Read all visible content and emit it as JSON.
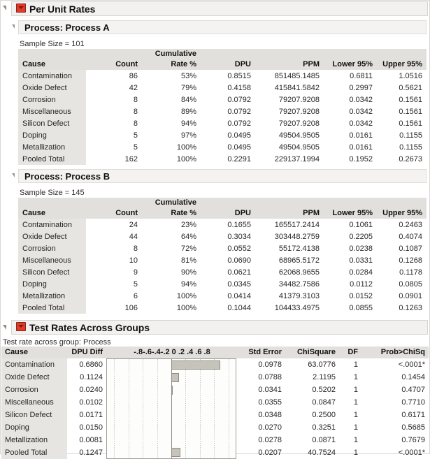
{
  "window": {
    "per_unit_rates_title": "Per Unit Rates",
    "test_rates_title": "Test Rates Across Groups"
  },
  "icons": {
    "popup": "red-popup-triangle-icon",
    "disclosure": "disclosure-triangle-icon"
  },
  "groups": [
    {
      "heading": "Process: Process A",
      "sample_size": "Sample Size = 101",
      "columns": [
        "Cause",
        "Count",
        "Cumulative\nRate %",
        "DPU",
        "PPM",
        "Lower 95%",
        "Upper 95%"
      ],
      "col_head_1": "Cause",
      "col_head_2": "Count",
      "col_head_3a": "Cumulative",
      "col_head_3b": "Rate %",
      "col_head_4": "DPU",
      "col_head_5": "PPM",
      "col_head_6": "Lower 95%",
      "col_head_7": "Upper 95%",
      "rows": [
        {
          "cause": "Contamination",
          "count": "86",
          "rate": "53%",
          "dpu": "0.8515",
          "ppm": "851485.1485",
          "lower": "0.6811",
          "upper": "1.0516"
        },
        {
          "cause": "Oxide Defect",
          "count": "42",
          "rate": "79%",
          "dpu": "0.4158",
          "ppm": "415841.5842",
          "lower": "0.2997",
          "upper": "0.5621"
        },
        {
          "cause": "Corrosion",
          "count": "8",
          "rate": "84%",
          "dpu": "0.0792",
          "ppm": "79207.9208",
          "lower": "0.0342",
          "upper": "0.1561"
        },
        {
          "cause": "Miscellaneous",
          "count": "8",
          "rate": "89%",
          "dpu": "0.0792",
          "ppm": "79207.9208",
          "lower": "0.0342",
          "upper": "0.1561"
        },
        {
          "cause": "Silicon Defect",
          "count": "8",
          "rate": "94%",
          "dpu": "0.0792",
          "ppm": "79207.9208",
          "lower": "0.0342",
          "upper": "0.1561"
        },
        {
          "cause": "Doping",
          "count": "5",
          "rate": "97%",
          "dpu": "0.0495",
          "ppm": "49504.9505",
          "lower": "0.0161",
          "upper": "0.1155"
        },
        {
          "cause": "Metallization",
          "count": "5",
          "rate": "100%",
          "dpu": "0.0495",
          "ppm": "49504.9505",
          "lower": "0.0161",
          "upper": "0.1155"
        },
        {
          "cause": "Pooled Total",
          "count": "162",
          "rate": "100%",
          "dpu": "0.2291",
          "ppm": "229137.1994",
          "lower": "0.1952",
          "upper": "0.2673"
        }
      ]
    },
    {
      "heading": "Process: Process B",
      "sample_size": "Sample Size = 145",
      "col_head_1": "Cause",
      "col_head_2": "Count",
      "col_head_3a": "Cumulative",
      "col_head_3b": "Rate %",
      "col_head_4": "DPU",
      "col_head_5": "PPM",
      "col_head_6": "Lower 95%",
      "col_head_7": "Upper 95%",
      "rows": [
        {
          "cause": "Contamination",
          "count": "24",
          "rate": "23%",
          "dpu": "0.1655",
          "ppm": "165517.2414",
          "lower": "0.1061",
          "upper": "0.2463"
        },
        {
          "cause": "Oxide Defect",
          "count": "44",
          "rate": "64%",
          "dpu": "0.3034",
          "ppm": "303448.2759",
          "lower": "0.2205",
          "upper": "0.4074"
        },
        {
          "cause": "Corrosion",
          "count": "8",
          "rate": "72%",
          "dpu": "0.0552",
          "ppm": "55172.4138",
          "lower": "0.0238",
          "upper": "0.1087"
        },
        {
          "cause": "Miscellaneous",
          "count": "10",
          "rate": "81%",
          "dpu": "0.0690",
          "ppm": "68965.5172",
          "lower": "0.0331",
          "upper": "0.1268"
        },
        {
          "cause": "Silicon Defect",
          "count": "9",
          "rate": "90%",
          "dpu": "0.0621",
          "ppm": "62068.9655",
          "lower": "0.0284",
          "upper": "0.1178"
        },
        {
          "cause": "Doping",
          "count": "5",
          "rate": "94%",
          "dpu": "0.0345",
          "ppm": "34482.7586",
          "lower": "0.0112",
          "upper": "0.0805"
        },
        {
          "cause": "Metallization",
          "count": "6",
          "rate": "100%",
          "dpu": "0.0414",
          "ppm": "41379.3103",
          "lower": "0.0152",
          "upper": "0.0901"
        },
        {
          "cause": "Pooled Total",
          "count": "106",
          "rate": "100%",
          "dpu": "0.1044",
          "ppm": "104433.4975",
          "lower": "0.0855",
          "upper": "0.1263"
        }
      ]
    }
  ],
  "test": {
    "caption": "Test rate across group: Process",
    "col_head_cause": "Cause",
    "col_head_dpudiff": "DPU Diff",
    "col_head_axis": "-.8-.6-.4-.2 0 .2 .4 .6 .8",
    "col_head_stderr": "Std Error",
    "col_head_chisquare": "ChiSquare",
    "col_head_df": "DF",
    "col_head_prob": "Prob>ChiSq",
    "rows": [
      {
        "cause": "Contamination",
        "dpu_diff": "0.6860",
        "std_error": "0.0978",
        "chisquare": "63.0776",
        "df": "1",
        "prob": "<.0001*",
        "sig": true
      },
      {
        "cause": "Oxide Defect",
        "dpu_diff": "0.1124",
        "std_error": "0.0788",
        "chisquare": "2.1195",
        "df": "1",
        "prob": "0.1454",
        "sig": false
      },
      {
        "cause": "Corrosion",
        "dpu_diff": "0.0240",
        "std_error": "0.0341",
        "chisquare": "0.5202",
        "df": "1",
        "prob": "0.4707",
        "sig": false
      },
      {
        "cause": "Miscellaneous",
        "dpu_diff": "0.0102",
        "std_error": "0.0355",
        "chisquare": "0.0847",
        "df": "1",
        "prob": "0.7710",
        "sig": false
      },
      {
        "cause": "Silicon Defect",
        "dpu_diff": "0.0171",
        "std_error": "0.0348",
        "chisquare": "0.2500",
        "df": "1",
        "prob": "0.6171",
        "sig": false
      },
      {
        "cause": "Doping",
        "dpu_diff": "0.0150",
        "std_error": "0.0270",
        "chisquare": "0.3251",
        "df": "1",
        "prob": "0.5685",
        "sig": false
      },
      {
        "cause": "Metallization",
        "dpu_diff": "0.0081",
        "std_error": "0.0278",
        "chisquare": "0.0871",
        "df": "1",
        "prob": "0.7679",
        "sig": false
      },
      {
        "cause": "Pooled Total",
        "dpu_diff": "0.1247",
        "std_error": "0.0207",
        "chisquare": "40.7524",
        "df": "1",
        "prob": "<.0001*",
        "sig": true
      }
    ]
  },
  "chart_data": {
    "type": "bar",
    "title": "DPU Diff",
    "orientation": "horizontal",
    "categories": [
      "Contamination",
      "Oxide Defect",
      "Corrosion",
      "Miscellaneous",
      "Silicon Defect",
      "Doping",
      "Metallization",
      "Pooled Total"
    ],
    "values": [
      0.686,
      0.1124,
      0.024,
      0.0102,
      0.0171,
      0.015,
      0.0081,
      0.1247
    ],
    "xlabel": "",
    "ylabel": "",
    "xlim": [
      -0.9,
      0.9
    ],
    "ticks": [
      -0.8,
      -0.6,
      -0.4,
      -0.2,
      0,
      0.2,
      0.4,
      0.6,
      0.8
    ],
    "tick_labels": [
      "-.8",
      "-.6",
      "-.4",
      "-.2",
      "0",
      ".2",
      ".4",
      ".6",
      ".8"
    ],
    "grid": true,
    "legend": "none",
    "bar_color": "#c6c4ba",
    "zero_line_color": "#8e8e88"
  },
  "colors": {
    "header_bg": "#e2e0dc",
    "cause_bg": "#e7e5e1",
    "title_bg": "#f2f1ef",
    "significant": "#e08020",
    "popup_red": "#e03a28"
  }
}
